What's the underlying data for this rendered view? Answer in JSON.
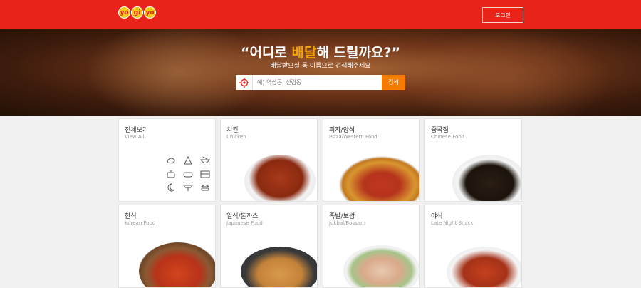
{
  "header": {
    "logo_letters": [
      "yo",
      "gi",
      "yo"
    ],
    "login_label": "로그인"
  },
  "hero": {
    "title_before": "“어디로 ",
    "title_accent": "배달",
    "title_after": "해 드릴까요?”",
    "subtitle": "배달받으실 동 이름으로 검색해주세요",
    "search_placeholder": "예) 역삼동, 신림동",
    "search_button": "검색"
  },
  "colors": {
    "brand_red": "#e8231a",
    "accent_orange": "#f6a400",
    "search_button": "#f77b00"
  },
  "categories": [
    {
      "title": "전체보기",
      "subtitle": "View All",
      "icon": "view-all-icons"
    },
    {
      "title": "치킨",
      "subtitle": "Chicken",
      "icon": "chicken-photo"
    },
    {
      "title": "피자/양식",
      "subtitle": "Pizza/Western Food",
      "icon": "pizza-photo"
    },
    {
      "title": "중국집",
      "subtitle": "Chinese Food",
      "icon": "jajangmyeon-photo"
    },
    {
      "title": "한식",
      "subtitle": "Korean Food",
      "icon": "stew-photo"
    },
    {
      "title": "일식/돈까스",
      "subtitle": "Japanese Food",
      "icon": "tonkatsu-photo"
    },
    {
      "title": "족발/보쌈",
      "subtitle": "Jokbal/Bossam",
      "icon": "bossam-photo"
    },
    {
      "title": "야식",
      "subtitle": "Late Night Snack",
      "icon": "late-night-photo"
    }
  ]
}
